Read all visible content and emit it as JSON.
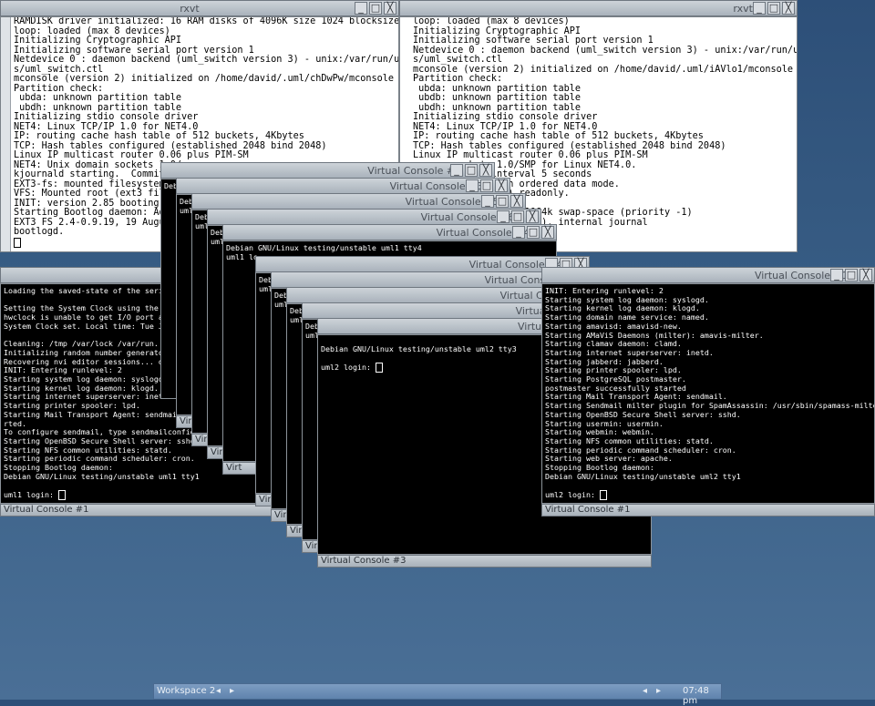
{
  "rxvt_left": {
    "title": "rxvt",
    "lines": [
      "RAMDISK driver initialized: 16 RAM disks of 4096K size 1024 blocksize",
      "loop: loaded (max 8 devices)",
      "Initializing Cryptographic API",
      "Initializing software serial port version 1",
      "Netdevice 0 : daemon backend (uml_switch version 3) - unix:/var/run/uml-utilitie",
      "s/uml_switch.ctl",
      "mconsole (version 2) initialized on /home/david/.uml/chDwPw/mconsole",
      "Partition check:",
      " ubda: unknown partition table",
      " ubdh: unknown partition table",
      "Initializing stdio console driver",
      "NET4: Linux TCP/IP 1.0 for NET4.0",
      "IP: routing cache hash table of 512 buckets, 4Kbytes",
      "TCP: Hash tables configured (established 2048 bind 2048)",
      "Linux IP multicast router 0.06 plus PIM-SM",
      "NET4: Unix domain sockets 1.0/",
      "kjournald starting.  Commit int",
      "EXT3-fs: mounted filesystem wit",
      "VFS: Mounted root (ext3 filesys",
      "INIT: version 2.85 booting",
      "Starting Bootlog daemon: Adding",
      "EXT3 FS 2.4-0.9.19, 19 August 2",
      "bootlogd."
    ]
  },
  "rxvt_right": {
    "title": "rxvt",
    "lines": [
      "loop: loaded (max 8 devices)",
      "Initializing Cryptographic API",
      "Initializing software serial port version 1",
      "Netdevice 0 : daemon backend (uml_switch version 3) - unix:/var/run/uml-utilitie",
      "s/uml_switch.ctl",
      "mconsole (version 2) initialized on /home/david/.uml/iAVlo1/mconsole",
      "Partition check:",
      " ubda: unknown partition table",
      " ubdb: unknown partition table",
      " ubdh: unknown partition table",
      "Initializing stdio console driver",
      "NET4: Linux TCP/IP 1.0 for NET4.0",
      "IP: routing cache hash table of 512 buckets, 4Kbytes",
      "TCP: Hash tables configured (established 2048 bind 2048)",
      "Linux IP multicast router 0.06 plus PIM-SM",
      "       sockets 1.0/SMP for Linux NET4.0.",
      "       Commit interval 5 seconds",
      "       system with ordered data mode.",
      "       filesystem) readonly.",
      "",
      "       ding Swap: 131064k swap-space (priority -1)",
      "       2002 on ubd(98,0), internal journal"
    ]
  },
  "vc_left": {
    "title": "Virtual Console #1",
    "lines": [
      "Loading the saved-state of the serial d",
      "",
      "Setting the System Clock using the Hard",
      "hwclock is unable to get I/O port acces",
      "System Clock set. Local time: Tue Jan",
      "",
      "Cleaning: /tmp /var/lock /var/run.",
      "Initializing random number generator...",
      "Recovering nvi editor sessions... done.",
      "INIT: Entering runlevel: 2",
      "Starting system log daemon: syslogd.",
      "Starting kernel log daemon: klogd.",
      "Starting internet superserver: inetd.",
      "Starting printer spooler: lpd.",
      "Starting Mail Transport Agent: sendmailsend",
      "rted.",
      "To configure sendmail, type sendmailconfig",
      "Starting OpenBSD Secure Shell server: sshd.",
      "Starting NFS common utilities: statd.",
      "Starting periodic command scheduler: cron.",
      "Stopping Bootlog daemon:",
      "Debian GNU/Linux testing/unstable uml1 tty1",
      "",
      "uml1 login: "
    ]
  },
  "vc_right": {
    "title": "Virtual Console #1",
    "lines": [
      "INIT: Entering runlevel: 2",
      "Starting system log daemon: syslogd.",
      "Starting kernel log daemon: klogd.",
      "Starting domain name service: named.",
      "Starting amavisd: amavisd-new.",
      "Starting AMaViS Daemons (milter): amavis-milter.",
      "Starting clamav daemon: clamd.",
      "Starting internet superserver: inetd.",
      "Starting jabberd: jabberd.",
      "Starting printer spooler: lpd.",
      "Starting PostgreSQL postmaster.",
      "postmaster successfully started",
      "Starting Mail Transport Agent: sendmail.",
      "Starting Sendmail milter plugin for SpamAssassin: /usr/sbin/spamass-milter",
      "Starting OpenBSD Secure Shell server: sshd.",
      "Starting usermin: usermin.",
      "Starting webmin: webmin.",
      "Starting NFS common utilities: statd.",
      "Starting periodic command scheduler: cron.",
      "Starting web server: apache.",
      "Stopping Bootlog daemon:",
      "Debian GNU/Linux testing/unstable uml2 tty1",
      "",
      "uml2 login: "
    ]
  },
  "vc3": {
    "title": "Virtual Console #3",
    "lines": [
      "Debian GNU/Linux testing/unstable uml2 tty3",
      "",
      "uml2 login: "
    ]
  },
  "stack_a": {
    "t2": "Virtual Console #2",
    "t3": "Virtual Console #3",
    "t5": "Virtual Console #5",
    "t6": "Virtual Console #6",
    "t4": "Virtual Console #4",
    "deb": "Deb",
    "uml": "uml",
    "uml1": "uml1",
    "virt": "Virt",
    "vc4_line1": "Debian GNU/Linux testing/unstable uml1 tty4",
    "vc4_line2": "uml1 lo"
  },
  "stack_b": {
    "t4": "Virtual Console #4",
    "t2": "Virtual Console",
    "t3": "Virtual Console",
    "t5": "Virtual Console",
    "t6": "Virtual Console",
    "deb": "Deb",
    "uml": "uml",
    "virt": "Virt",
    "virtual": "Virtual C"
  },
  "taskbar": {
    "workspace": "Workspace 2",
    "left_arrow": "◂",
    "right_arrow": "▸",
    "arrow_left2": "◂",
    "arrow_right2": "▸",
    "clock": "07:48 pm"
  },
  "window_buttons": {
    "min": "_",
    "max": "□",
    "close": "╳"
  }
}
